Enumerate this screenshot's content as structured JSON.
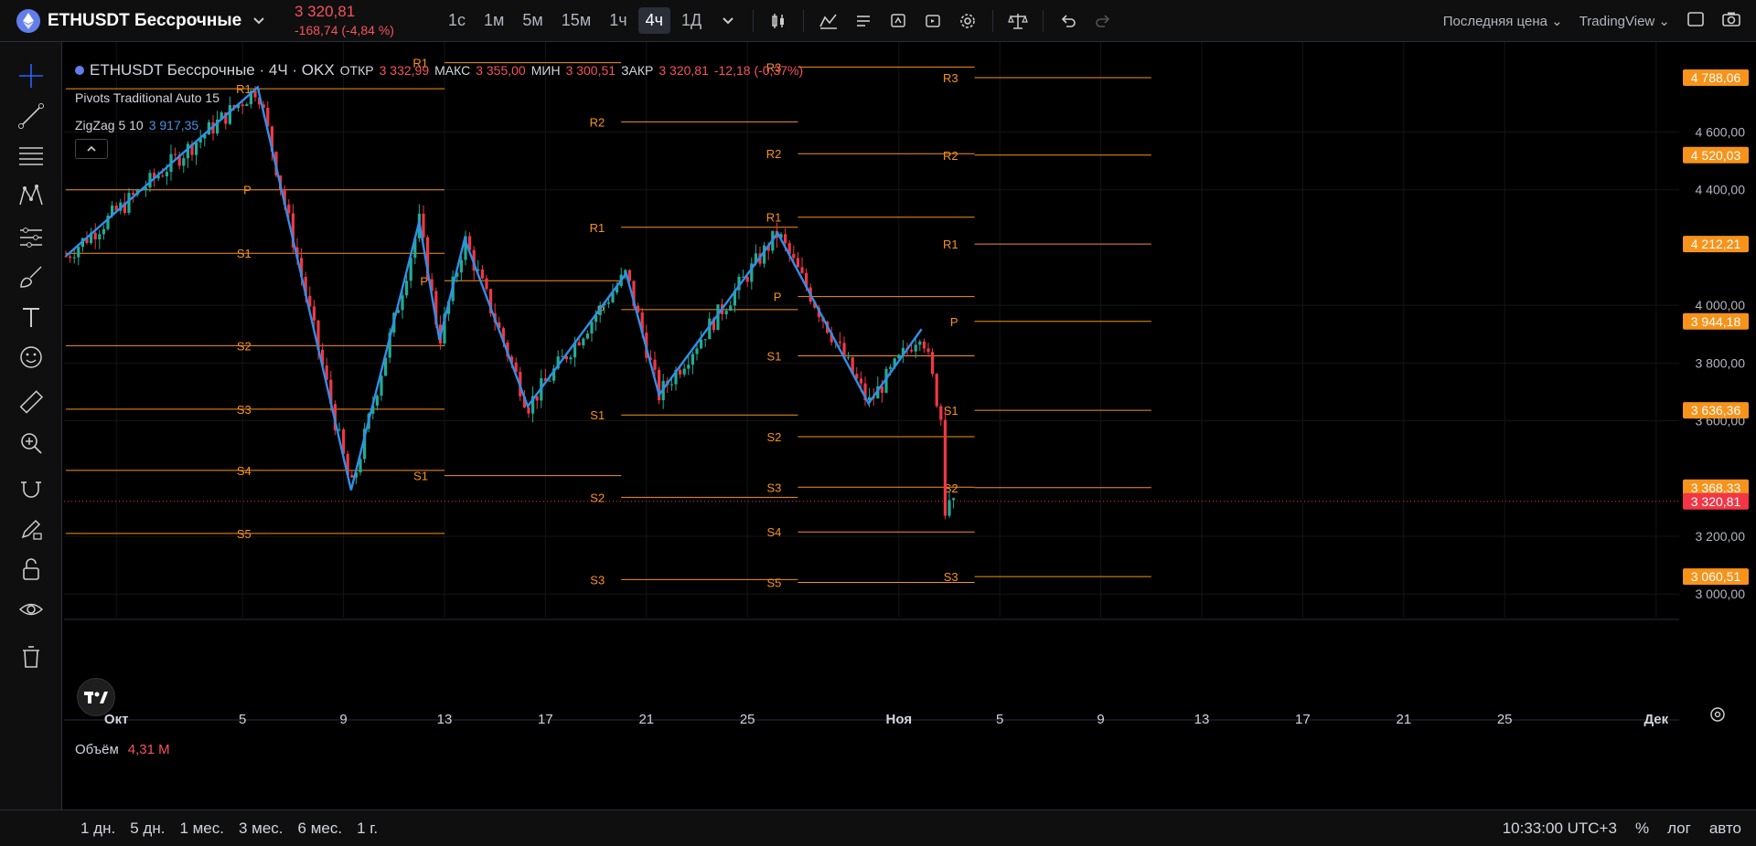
{
  "header": {
    "symbol": "ETHUSDT Бессрочные",
    "price": "3 320,81",
    "change": "-168,74 (-4,84 %)",
    "timeframes": [
      {
        "label": "1с",
        "active": false
      },
      {
        "label": "1м",
        "active": false
      },
      {
        "label": "5м",
        "active": false
      },
      {
        "label": "15м",
        "active": false
      },
      {
        "label": "1ч",
        "active": false
      },
      {
        "label": "4ч",
        "active": true
      },
      {
        "label": "1Д",
        "active": false
      }
    ],
    "price_type": "Последняя цена",
    "layout_name": "TradingView"
  },
  "legend": {
    "title": "ETHUSDT Бессрочные · 4Ч · OKX",
    "open_label": "ОТКР",
    "open": "3 332,99",
    "high_label": "МАКС",
    "high": "3 355,00",
    "low_label": "МИН",
    "low": "3 300,51",
    "close_label": "ЗАКР",
    "close": "3 320,81",
    "change": "-12,18 (-0,37%)",
    "pivots": "Pivots Traditional Auto 15",
    "zigzag_label": "ZigZag 5 10",
    "zigzag_value": "3 917,35"
  },
  "volume": {
    "label": "Объём",
    "value": "4,31 M"
  },
  "bottom": {
    "ranges": [
      "1 дн.",
      "5 дн.",
      "1 мес.",
      "3 мес.",
      "6 мес.",
      "1 г."
    ],
    "time": "10:33:00 UTC+3",
    "percent": "%",
    "log": "лог",
    "auto": "авто"
  },
  "chart_data": {
    "type": "candlestick",
    "x_ticks": [
      "Окт",
      "5",
      "9",
      "13",
      "17",
      "21",
      "25",
      "Ноя",
      "5",
      "9",
      "13",
      "17",
      "21",
      "25",
      "Дек"
    ],
    "y_ticks": [
      "4 600,00",
      "4 400,00",
      "4 000,00",
      "3 800,00",
      "3 600,00",
      "3 200,00",
      "3 000,00"
    ],
    "ylim": [
      2950,
      4880
    ],
    "price_labels": [
      {
        "value": 4788.06,
        "text": "4 788,06",
        "color": "#f7931a"
      },
      {
        "value": 4520.03,
        "text": "4 520,03",
        "color": "#f7931a"
      },
      {
        "value": 4212.21,
        "text": "4 212,21",
        "color": "#f7931a"
      },
      {
        "value": 3944.18,
        "text": "3 944,18",
        "color": "#f7931a"
      },
      {
        "value": 3636.36,
        "text": "3 636,36",
        "color": "#f7931a"
      },
      {
        "value": 3368.33,
        "text": "3 368,33",
        "color": "#f7931a"
      },
      {
        "value": 3320.81,
        "text": "3 320,81",
        "color": "#f23645"
      },
      {
        "value": 3060.51,
        "text": "3 060,51",
        "color": "#f7931a"
      }
    ],
    "pivot_colors": {
      "line": "#f7931a"
    },
    "zigzag_color": "#2f8fe8",
    "pivot_groups": [
      {
        "x_start": "Sep 28",
        "x_end": "Oct 6",
        "levels": [
          {
            "name": "R1",
            "value": 4750
          },
          {
            "name": "P",
            "value": 4400
          },
          {
            "name": "S1",
            "value": 4180
          },
          {
            "name": "S2",
            "value": 3860
          },
          {
            "name": "S3",
            "value": 3640
          },
          {
            "name": "S4",
            "value": 3428
          },
          {
            "name": "S5",
            "value": 3210
          }
        ]
      },
      {
        "x_start": "Oct 6",
        "x_end": "Oct 13",
        "levels": [
          {
            "name": "R1",
            "value": 4750
          },
          {
            "name": "P",
            "value": 4400
          },
          {
            "name": "S1",
            "value": 4180
          },
          {
            "name": "S2",
            "value": 3860
          },
          {
            "name": "S3",
            "value": 3640
          },
          {
            "name": "S4",
            "value": 3428
          },
          {
            "name": "S5",
            "value": 3210
          }
        ]
      },
      {
        "x_start": "Oct 13",
        "x_end": "Oct 20",
        "levels": [
          {
            "name": "R1",
            "value": 4840
          },
          {
            "name": "P",
            "value": 4085
          },
          {
            "name": "S1",
            "value": 3410
          }
        ]
      },
      {
        "x_start": "Oct 20",
        "x_end": "Oct 27",
        "levels": [
          {
            "name": "R2",
            "value": 4635
          },
          {
            "name": "R1",
            "value": 4270
          },
          {
            "name": "P",
            "value": 3985
          },
          {
            "name": "S1",
            "value": 3620
          },
          {
            "name": "S2",
            "value": 3335
          },
          {
            "name": "S3",
            "value": 3050
          }
        ]
      },
      {
        "x_start": "Oct 27",
        "x_end": "Nov 3",
        "levels": [
          {
            "name": "R3",
            "value": 4825
          },
          {
            "name": "R2",
            "value": 4525
          },
          {
            "name": "R1",
            "value": 4305
          },
          {
            "name": "P",
            "value": 4030
          },
          {
            "name": "S1",
            "value": 3825
          },
          {
            "name": "S2",
            "value": 3545
          },
          {
            "name": "S3",
            "value": 3370
          },
          {
            "name": "S4",
            "value": 3215
          },
          {
            "name": "S5",
            "value": 3040
          }
        ]
      },
      {
        "x_start": "Nov 3",
        "x_end": "Nov 10",
        "levels": [
          {
            "name": "R3",
            "value": 4788.06
          },
          {
            "name": "R2",
            "value": 4520.03
          },
          {
            "name": "R1",
            "value": 4212.21
          },
          {
            "name": "P",
            "value": 3944.18
          },
          {
            "name": "S1",
            "value": 3636.36
          },
          {
            "name": "S2",
            "value": 3368.33
          },
          {
            "name": "S3",
            "value": 3060.51
          }
        ]
      }
    ],
    "zigzag": [
      {
        "d": 0,
        "v": 4170
      },
      {
        "d": 7.6,
        "v": 4755
      },
      {
        "d": 11.3,
        "v": 3360
      },
      {
        "d": 14.0,
        "v": 4290
      },
      {
        "d": 14.8,
        "v": 3880
      },
      {
        "d": 15.8,
        "v": 4230
      },
      {
        "d": 18.3,
        "v": 3650
      },
      {
        "d": 22.2,
        "v": 4110
      },
      {
        "d": 23.5,
        "v": 3690
      },
      {
        "d": 28.2,
        "v": 4250
      },
      {
        "d": 31.8,
        "v": 3660
      },
      {
        "d": 33.9,
        "v": 3917.35
      }
    ],
    "current_price": 3320.81
  }
}
